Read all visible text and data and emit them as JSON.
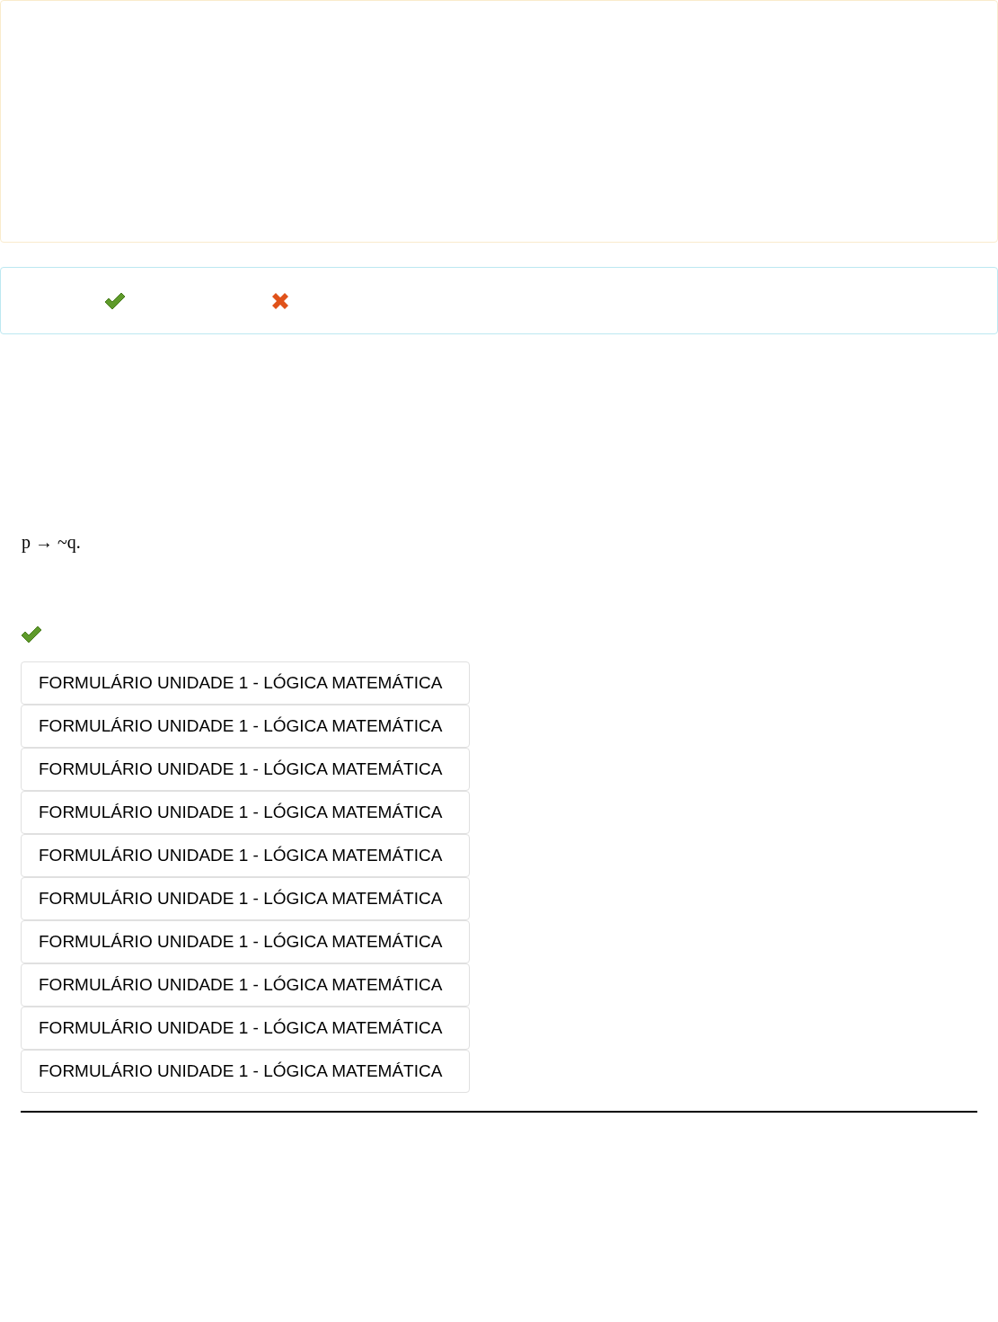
{
  "legend": [
    {
      "kind": "correct"
    },
    {
      "kind": "wrong"
    }
  ],
  "formula": "p → ~q.",
  "result": {
    "kind": "correct"
  },
  "links": [
    "FORMULÁRIO UNIDADE 1 - LÓGICA MATEMÁTICA",
    "FORMULÁRIO UNIDADE 1 - LÓGICA MATEMÁTICA",
    "FORMULÁRIO UNIDADE 1 - LÓGICA MATEMÁTICA",
    "FORMULÁRIO UNIDADE 1 - LÓGICA MATEMÁTICA",
    "FORMULÁRIO UNIDADE 1 - LÓGICA MATEMÁTICA",
    "FORMULÁRIO UNIDADE 1 - LÓGICA MATEMÁTICA",
    "FORMULÁRIO UNIDADE 1 - LÓGICA MATEMÁTICA",
    "FORMULÁRIO UNIDADE 1 - LÓGICA MATEMÁTICA",
    "FORMULÁRIO UNIDADE 1 - LÓGICA MATEMÁTICA",
    "FORMULÁRIO UNIDADE 1 - LÓGICA MATEMÁTICA"
  ]
}
